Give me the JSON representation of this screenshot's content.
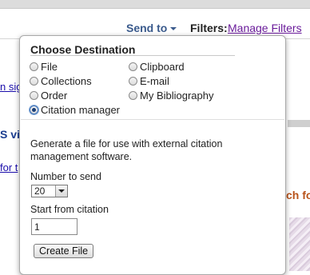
{
  "header": {
    "send_to_label": "Send to",
    "filters_label": "Filters:",
    "manage_filters_label": "Manage Filters"
  },
  "background": {
    "link_fragments": [
      "n sig",
      "for t"
    ],
    "bold_fragment": "S vi",
    "orange_fragment": "ch fo"
  },
  "popup": {
    "title": "Choose Destination",
    "options_left": [
      {
        "label": "File",
        "checked": false
      },
      {
        "label": "Collections",
        "checked": false
      },
      {
        "label": "Order",
        "checked": false
      },
      {
        "label": "Citation manager",
        "checked": true
      }
    ],
    "options_right": [
      {
        "label": "Clipboard",
        "checked": false
      },
      {
        "label": "E-mail",
        "checked": false
      },
      {
        "label": "My Bibliography",
        "checked": false
      }
    ],
    "description": "Generate a file for use with external citation management software.",
    "number_to_send_label": "Number to send",
    "number_to_send_value": "20",
    "start_from_label": "Start from citation",
    "start_from_value": "1",
    "create_button_label": "Create File"
  }
}
